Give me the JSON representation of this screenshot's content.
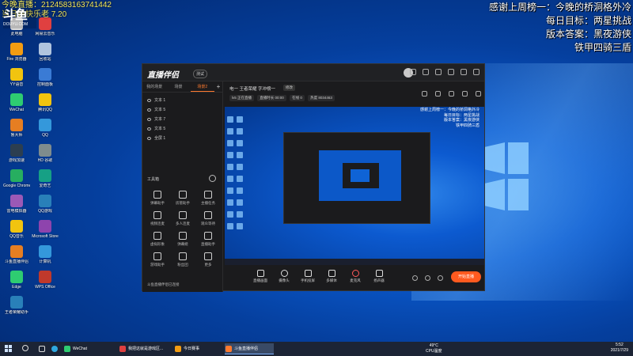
{
  "overlay": {
    "top_left_line1": "今晚直播：2124583163741442",
    "top_left_line2": "当日是快乐老 7.20",
    "douyu_logo": "斗鱼",
    "douyu_sub": "DOUYU.COM",
    "right_lines": [
      "感谢上周榜一：今晚的桥洞格外冷",
      "每日目标：两星挑战",
      "版本答案：黑夜游侠",
      "铁甲四骑三盾"
    ]
  },
  "desktop_icons": [
    {
      "label": "此电脑",
      "color": "#d9d9d9"
    },
    {
      "label": "网易云音乐",
      "color": "#e04040"
    },
    {
      "label": "Fire 浏览器",
      "color": "#f39c12"
    },
    {
      "label": "回收站",
      "color": "#b0c4de"
    },
    {
      "label": "YY语音",
      "color": "#f1c40f"
    },
    {
      "label": "控制面板",
      "color": "#3a7bd5"
    },
    {
      "label": "WeChat",
      "color": "#2ecc71"
    },
    {
      "label": "腾讯QQ",
      "color": "#f1c40f"
    },
    {
      "label": "鲁大师",
      "color": "#e67e22"
    },
    {
      "label": "QQ",
      "color": "#3498db"
    },
    {
      "label": "游戏加速",
      "color": "#2c3e50"
    },
    {
      "label": "HD 谷歌",
      "color": "#7f8c8d"
    },
    {
      "label": "Google Chrome",
      "color": "#27ae60"
    },
    {
      "label": "爱奇艺",
      "color": "#16a085"
    },
    {
      "label": "雷电模拟器",
      "color": "#9b59b6"
    },
    {
      "label": "QQ游戏",
      "color": "#2980b9"
    },
    {
      "label": "QQ音乐",
      "color": "#f1c40f"
    },
    {
      "label": "Microsoft Store",
      "color": "#8e44ad"
    },
    {
      "label": "斗鱼直播伴侣",
      "color": "#e67e22"
    },
    {
      "label": "计算机",
      "color": "#3498db"
    },
    {
      "label": "Edge",
      "color": "#2ecc71"
    },
    {
      "label": "WPS Office",
      "color": "#c0392b"
    },
    {
      "label": "王者荣耀助手",
      "color": "#2980b9"
    }
  ],
  "app": {
    "logo": "直播伴侣",
    "badge": "测试",
    "tabs": [
      "我的场景",
      "场景",
      "场景2"
    ],
    "active_tab": 2,
    "add_tab": "+",
    "scenes": [
      "文本 1",
      "文本 5",
      "文本 7",
      "文本 5",
      "全屏 1"
    ],
    "tools_title": "工具箱",
    "tools": [
      "弹幕助手",
      "房管助手",
      "主播任务",
      "视频连麦",
      "多人连麦",
      "观众等待",
      "虚拟形象",
      "弹幕姬",
      "直播助手",
      "游戏助手",
      "粉丝团",
      "更多"
    ],
    "status": "斗鱼直播伴侣已连接",
    "stream_title": "电一 王者荣耀 字冲榜一",
    "title_tag": "修改",
    "stats": [
      "lv5 正在直播",
      "直播时长 00:00",
      "在线 0",
      "热度 8034463"
    ],
    "bottom_items": [
      "直播画面",
      "摄像头",
      "手机投屏",
      "多媒体",
      "麦克风",
      "扬声器"
    ],
    "start_button": "开始直播",
    "preview_overlay": [
      "感谢上周榜一：今晚的桥洞格外冷",
      "每日目标：两星挑战",
      "版本答案：黑夜游侠",
      "铁甲四骑三盾"
    ]
  },
  "taskbar": {
    "items": [
      "WeChat",
      "我把这就是游戏区...",
      "今日赛事",
      "斗鱼直播伴侣"
    ],
    "temp": "49°C",
    "temp_label": "CPU温度",
    "time": "5:52",
    "date": "2021/7/29"
  }
}
